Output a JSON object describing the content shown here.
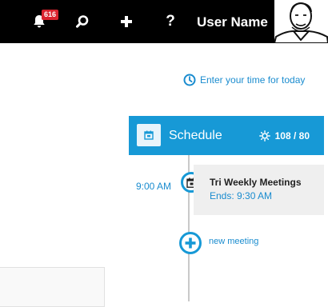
{
  "topbar": {
    "notification_count": "616",
    "icons": [
      "bell-icon",
      "search-icon",
      "plus-icon",
      "help-icon"
    ],
    "help_glyph": "?",
    "user_name": "User Name"
  },
  "time_entry": {
    "label": "Enter your time for today",
    "icon": "clock-icon"
  },
  "schedule": {
    "title": "Schedule",
    "stat": "108 / 80",
    "stat_icon": "sun-icon",
    "events": [
      {
        "time": "9:00 AM",
        "title": "Tri Weekly Meetings",
        "ends": "Ends: 9:30 AM"
      }
    ],
    "add_label": "new meeting"
  },
  "colors": {
    "accent": "#1799d6",
    "link": "#1a8ccf",
    "topbar": "#000000",
    "badge": "#d9232e"
  }
}
